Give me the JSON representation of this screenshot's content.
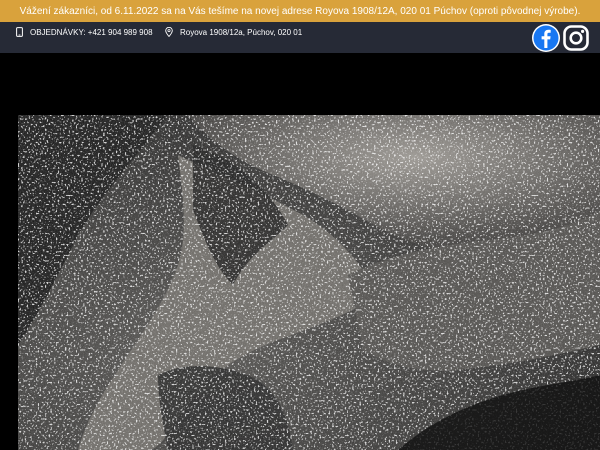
{
  "notice": {
    "text": "Vážení zákazníci, od 6.11.2022 sa na Vás tešíme na novej adrese Royova 1908/12A, 020 01 Púchov (oproti pôvodnej výrobe)."
  },
  "topbar": {
    "phone": {
      "icon": "phone-icon",
      "text": "OBJEDNÁVKY: +421 904 989 908"
    },
    "address": {
      "icon": "location-pin-icon",
      "text": "Royova 1908/12a, Púchov, 020 01"
    },
    "social": [
      {
        "name": "facebook",
        "icon": "facebook-icon"
      },
      {
        "name": "instagram",
        "icon": "instagram-icon"
      }
    ]
  },
  "colors": {
    "notice_bg": "#d9a23c",
    "topbar_bg": "#262a36",
    "page_bg": "#000000",
    "facebook_blue": "#1877f2"
  }
}
